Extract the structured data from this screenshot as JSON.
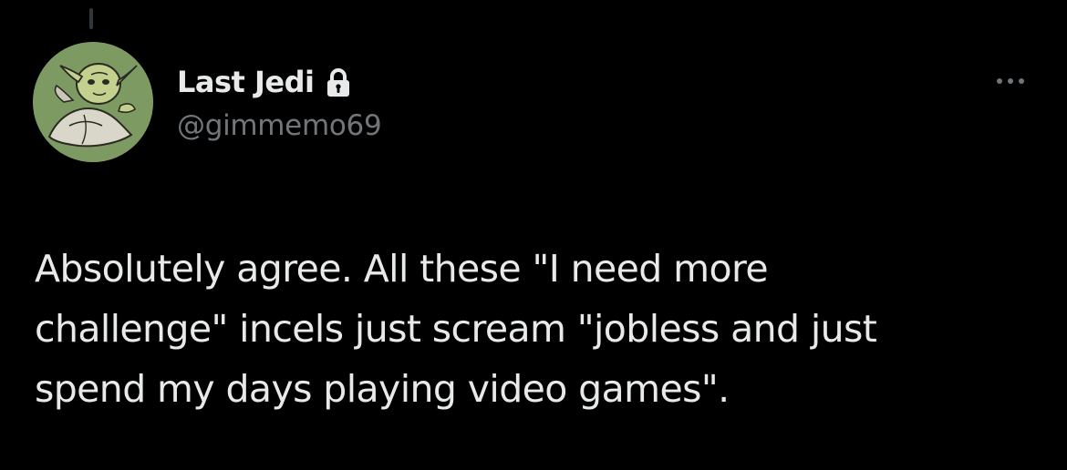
{
  "tweet": {
    "author": {
      "display_name": "Last Jedi",
      "handle": "@gimmemo69",
      "protected_icon": "lock-icon",
      "avatar": "yoda-avatar"
    },
    "text_lines": [
      "Absolutely agree. All these \"I need more",
      "challenge\" incels just scream \"jobless and just",
      "spend my days playing video games\"."
    ],
    "more_icon": "more-horizontal-icon"
  },
  "colors": {
    "background": "#000000",
    "primary_text": "#e7e9ea",
    "secondary_text": "#71767b",
    "thread_line": "#333639",
    "avatar_bg": "#7e9a63"
  }
}
